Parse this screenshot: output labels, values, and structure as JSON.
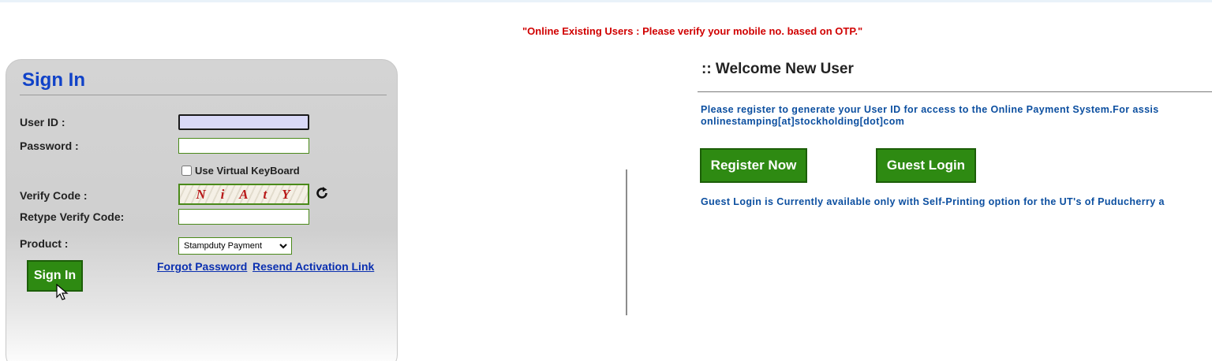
{
  "notice": "\"Online Existing Users : Please verify your mobile no. based on OTP.\"",
  "signin": {
    "title": "Sign In",
    "user_id_label": "User ID :",
    "password_label": "Password :",
    "virtual_keyboard_label": "Use Virtual KeyBoard",
    "verify_code_label": "Verify Code :",
    "captcha_chars": [
      "N",
      "i",
      "A",
      "t",
      "Y"
    ],
    "retype_label": "Retype Verify Code:",
    "product_label": "Product :",
    "product_selected": "Stampduty Payment",
    "button_label": "Sign In",
    "forgot_password": "Forgot Password",
    "resend_activation": "Resend Activation Link"
  },
  "welcome": {
    "title": ":: Welcome New User",
    "line1": "Please register to generate your User ID for access to the Online Payment System.For assis",
    "line2": "onlinestamping[at]stockholding[dot]com",
    "register_button": "Register Now",
    "guest_button": "Guest Login",
    "guest_note": "Guest Login is Currently available only with Self-Printing option for the UT's of Puducherry a"
  },
  "colors": {
    "accent_green": "#2e8a12",
    "title_blue": "#1042c8",
    "notice_red": "#d00000",
    "text_blue": "#0c4fa0"
  }
}
